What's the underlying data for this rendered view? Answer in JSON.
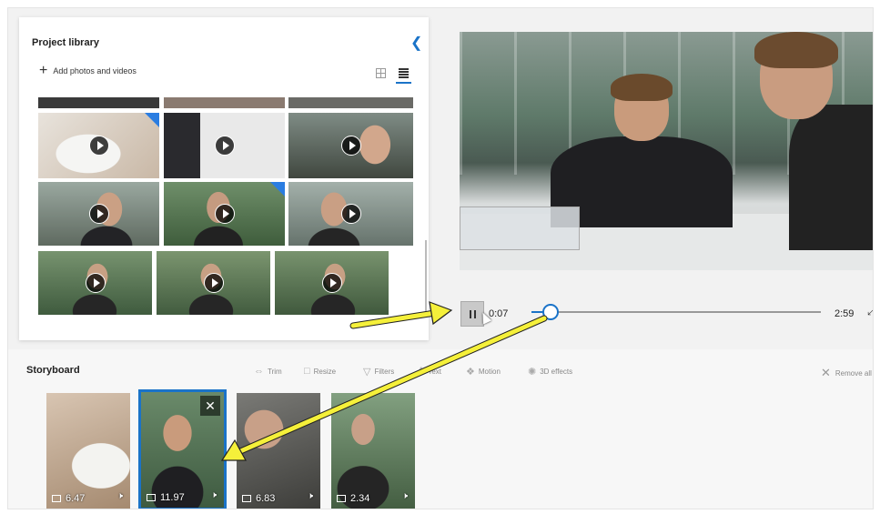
{
  "library": {
    "title": "Project library",
    "add_label": "Add photos and videos"
  },
  "playback": {
    "current_time": "0:07",
    "total_time": "2:59",
    "progress": 0.04
  },
  "storyboard": {
    "title": "Storyboard",
    "tools": [
      {
        "label": "Trim",
        "icon": "trim-icon"
      },
      {
        "label": "Resize",
        "icon": "resize-icon"
      },
      {
        "label": "Filters",
        "icon": "filters-icon"
      },
      {
        "label": "Text",
        "icon": "text-icon"
      },
      {
        "label": "Motion",
        "icon": "motion-icon"
      },
      {
        "label": "3D effects",
        "icon": "3d-effects-icon"
      }
    ],
    "remove_all": "Remove all",
    "clips": [
      {
        "duration": "6.47"
      },
      {
        "duration": "11.97"
      },
      {
        "duration": "6.83"
      },
      {
        "duration": "2.34"
      }
    ]
  },
  "colors": {
    "accent": "#1a73c8",
    "annotation_arrow": "#f5f03a"
  }
}
